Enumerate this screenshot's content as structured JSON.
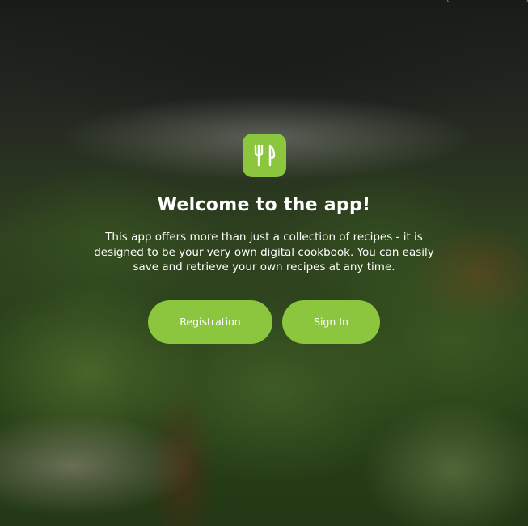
{
  "welcome": {
    "title": "Welcome to the app!",
    "description": "This app offers more than just a collection of recipes - it is designed to be your very own digital cookbook. You can easily save and retrieve your own recipes at any time.",
    "logo_icon": "fork-knife-icon",
    "background_image": "salad-bowl"
  },
  "actions": {
    "registration_label": "Registration",
    "signin_label": "Sign In"
  },
  "colors": {
    "accent": "#8cc63f",
    "text": "#ffffff"
  }
}
